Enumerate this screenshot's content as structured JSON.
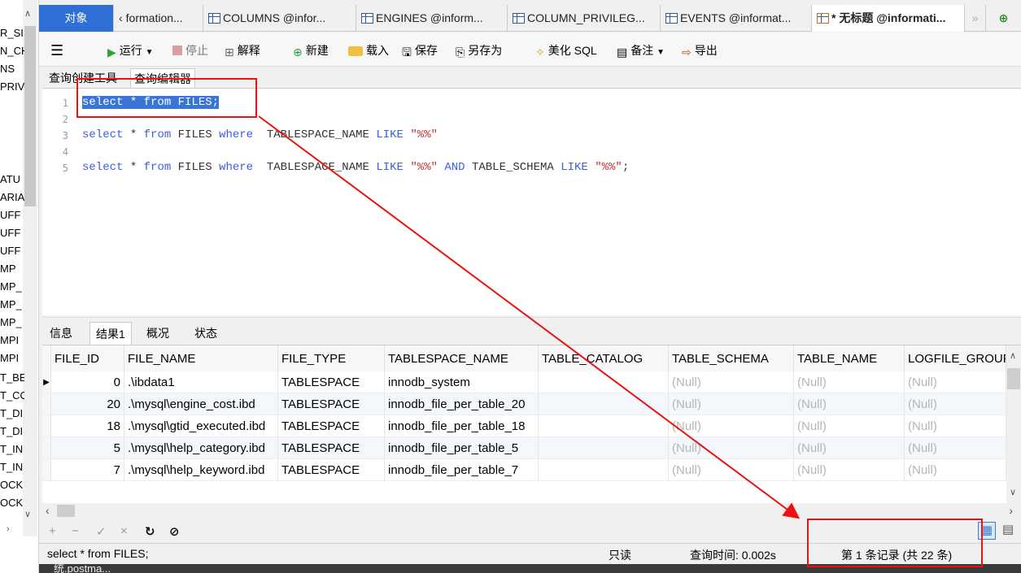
{
  "sidebar": {
    "items": [
      "R_SI",
      "N_CH",
      "NS",
      "PRIV",
      "ATU",
      "ARIA",
      "UFF",
      "UFF",
      "UFF",
      "MP",
      "MP_",
      "MP_",
      "MP_",
      "MPI",
      "MPI",
      "T_BE",
      "T_CC",
      "T_DI",
      "T_DI",
      "T_IN",
      "T_IN",
      "OCK",
      "OCK"
    ]
  },
  "tabs": {
    "objects": "对象",
    "items": [
      "formation...",
      "COLUMNS @infor...",
      "ENGINES @inform...",
      "COLUMN_PRIVILEG...",
      "EVENTS @informat...",
      "* 无标题 @informati..."
    ]
  },
  "toolbar": {
    "run": "运行",
    "stop": "停止",
    "explain": "解释",
    "new": "新建",
    "load": "载入",
    "save": "保存",
    "save_as": "另存为",
    "beautify": "美化 SQL",
    "notes": "备注",
    "export": "导出"
  },
  "subtabs": {
    "builder": "查询创建工具",
    "editor": "查询编辑器"
  },
  "editor": {
    "line_numbers": [
      "1",
      "2",
      "3",
      "4",
      "5"
    ],
    "line1": "select * from FILES;",
    "line3": {
      "kw1": "select",
      "t1": " * ",
      "kw2": "from",
      "t2": " FILES ",
      "kw3": "where",
      "t3": "  TABLESPACE_NAME ",
      "kw4": "LIKE",
      "t4": " ",
      "s1": "\"%%\""
    },
    "line5": {
      "kw1": "select",
      "t1": " * ",
      "kw2": "from",
      "t2": " FILES ",
      "kw3": "where",
      "t3": "  TABLESPACE_NAME ",
      "kw4": "LIKE",
      "t4": " ",
      "s1": "\"%%\"",
      "t5": " ",
      "kw5": "AND",
      "t6": " TABLE_SCHEMA ",
      "kw6": "LIKE",
      "t7": " ",
      "s2": "\"%%\"",
      "t8": ";"
    }
  },
  "result_tabs": [
    "信息",
    "结果1",
    "概况",
    "状态"
  ],
  "grid": {
    "columns": [
      "FILE_ID",
      "FILE_NAME",
      "FILE_TYPE",
      "TABLESPACE_NAME",
      "TABLE_CATALOG",
      "TABLE_SCHEMA",
      "TABLE_NAME",
      "LOGFILE_GROUP"
    ],
    "rows": [
      [
        "0",
        ".\\ibdata1",
        "TABLESPACE",
        "innodb_system",
        "",
        "(Null)",
        "(Null)",
        "(Null)"
      ],
      [
        "20",
        ".\\mysql\\engine_cost.ibd",
        "TABLESPACE",
        "innodb_file_per_table_20",
        "",
        "(Null)",
        "(Null)",
        "(Null)"
      ],
      [
        "18",
        ".\\mysql\\gtid_executed.ibd",
        "TABLESPACE",
        "innodb_file_per_table_18",
        "",
        "(Null)",
        "(Null)",
        "(Null)"
      ],
      [
        "5",
        ".\\mysql\\help_category.ibd",
        "TABLESPACE",
        "innodb_file_per_table_5",
        "",
        "(Null)",
        "(Null)",
        "(Null)"
      ],
      [
        "7",
        ".\\mysql\\help_keyword.ibd",
        "TABLESPACE",
        "innodb_file_per_table_7",
        "",
        "(Null)",
        "(Null)",
        "(Null)"
      ]
    ]
  },
  "status": {
    "sql": "select * from FILES;",
    "readonly": "只读",
    "query_time": "查询时间: 0.002s",
    "records": "第 1 条记录 (共 22 条)"
  },
  "taskbar_text": "统.postma..."
}
